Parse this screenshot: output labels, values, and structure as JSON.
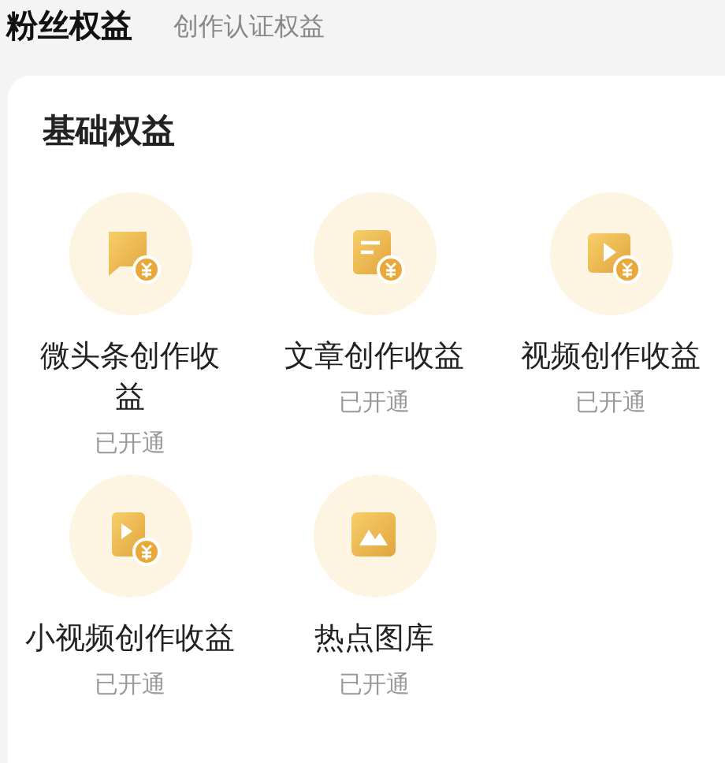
{
  "tabs": [
    {
      "label": "粉丝权益",
      "selected": true
    },
    {
      "label": "创作认证权益",
      "selected": false
    }
  ],
  "section": {
    "title": "基础权益"
  },
  "benefits": [
    {
      "kind": "chat",
      "label": "微头条创作收益",
      "status": "已开通"
    },
    {
      "kind": "article",
      "label": "文章创作收益",
      "status": "已开通"
    },
    {
      "kind": "video",
      "label": "视频创作收益",
      "status": "已开通"
    },
    {
      "kind": "small-video",
      "label": "小视频创作收益",
      "status": "已开通"
    },
    {
      "kind": "image",
      "label": "热点图库",
      "status": "已开通"
    }
  ]
}
